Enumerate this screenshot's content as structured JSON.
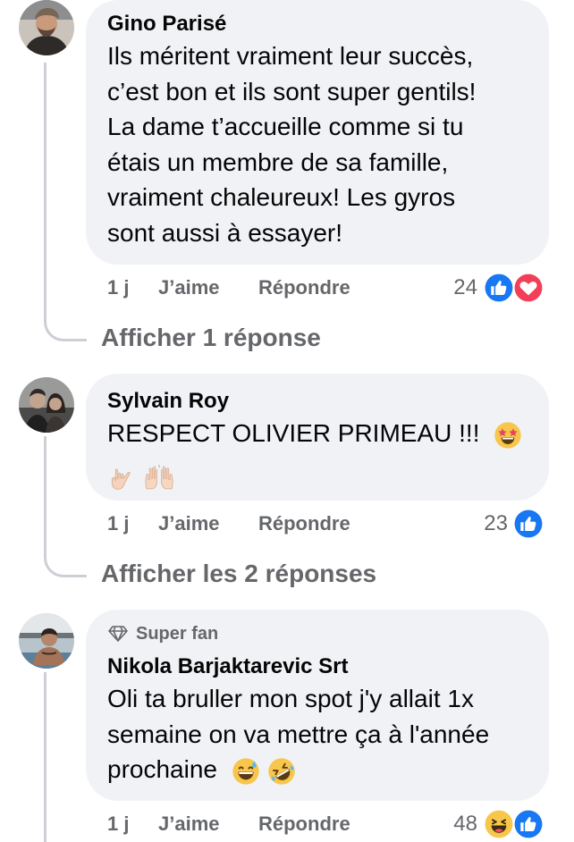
{
  "comments": [
    {
      "author": "Gino Parisé",
      "lines": [
        "Ils méritent vraiment leur succès,",
        "c’est bon et ils sont super gentils!",
        "La dame t’accueille comme si tu",
        "étais un membre de sa famille,",
        "vraiment chaleureux! Les gyros",
        "sont aussi à essayer!"
      ],
      "time": "1 j",
      "like_label": "J’aime",
      "reply_label": "Répondre",
      "reaction_count": "24",
      "reaction_icons": [
        "like-icon",
        "love-icon"
      ],
      "view_replies": "Afficher 1 réponse"
    },
    {
      "author": "Sylvain Roy",
      "lines": [
        "RESPECT OLIVIER PRIMEAU !!!"
      ],
      "emojis": [
        "star-struck-emoji",
        "love-you-gesture-emoji",
        "raising-hands-emoji"
      ],
      "time": "1 j",
      "like_label": "J’aime",
      "reply_label": "Répondre",
      "reaction_count": "23",
      "reaction_icons": [
        "like-icon"
      ],
      "view_replies": "Afficher les 2 réponses"
    },
    {
      "badge": "Super fan",
      "badge_icon": "diamond-icon",
      "author": "Nikola Barjaktarevic Srt",
      "lines": [
        "Oli ta bruller mon spot j'y allait 1x",
        "semaine on va mettre ça à l'année",
        "prochaine"
      ],
      "emojis": [
        "grinning-sweat-emoji",
        "rofl-emoji"
      ],
      "time": "1 j",
      "like_label": "J’aime",
      "reply_label": "Répondre",
      "reaction_count": "48",
      "reaction_icons": [
        "haha-icon",
        "like-icon"
      ]
    }
  ],
  "colors": {
    "bubble": "#f0f2f5",
    "secondary_text": "#65676b",
    "like_blue": "#1877f2",
    "love_red": "#f33e58",
    "thread_line": "#ccd0d5"
  }
}
